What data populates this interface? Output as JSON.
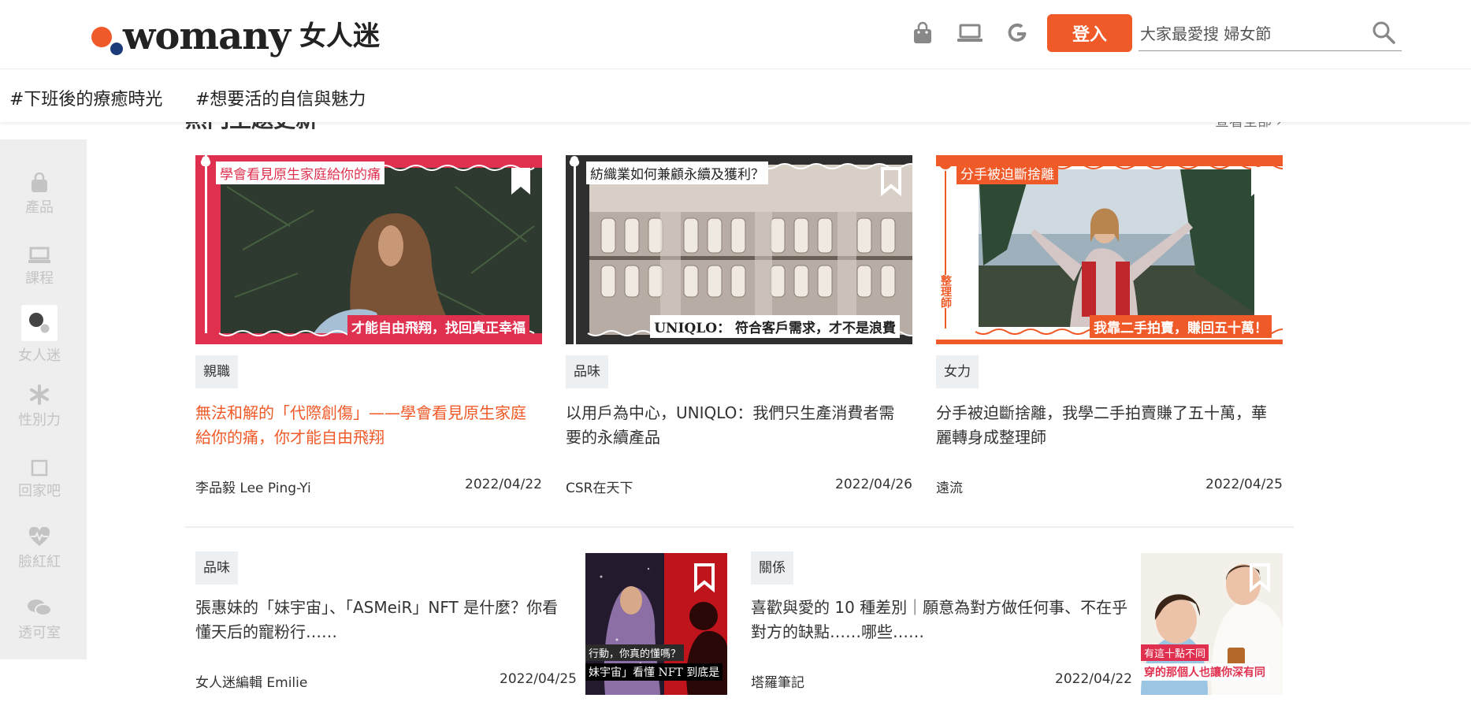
{
  "header": {
    "logo_word": "womany",
    "logo_cn": "女人迷",
    "login_label": "登入",
    "search_placeholder": "大家最愛搜 婦女節",
    "icons": [
      "shopping-bag-icon",
      "laptop-icon",
      "google-icon",
      "search-icon"
    ]
  },
  "tags": [
    "#下班後的療癒時光",
    "#想要活的自信與魅力"
  ],
  "sidebar": {
    "items": [
      {
        "label": "產品",
        "icon": "shopping-bag-icon"
      },
      {
        "label": "課程",
        "icon": "laptop-icon"
      },
      {
        "label": "女人迷",
        "icon": "womany-dots-icon"
      },
      {
        "label": "性別力",
        "icon": "asterisk-icon"
      },
      {
        "label": "回家吧",
        "icon": "square-icon"
      },
      {
        "label": "臉紅紅",
        "icon": "heart-pulse-icon"
      },
      {
        "label": "透可室",
        "icon": "chat-bubbles-icon"
      }
    ]
  },
  "section": {
    "title": "熱門主題更新",
    "more": "查看全部 ›"
  },
  "cards": [
    {
      "thumb_top": "學會看見原生家庭給你的痛",
      "thumb_bottom": "才能自由飛翔，找回真正幸福",
      "category": "親職",
      "title": "無法和解的「代際創傷」——學會看見原生家庭給你的痛，你才能自由飛翔",
      "author": "李品毅 Lee Ping-Yi",
      "date": "2022/04/22"
    },
    {
      "thumb_top": "紡織業如何兼顧永續及獲利？",
      "thumb_bottom": "UNIQLO： 符合客戶需求，才不是浪費",
      "category": "品味",
      "title": "以用戶為中心，UNIQLO：我們只生產消費者需要的永續產品",
      "author": "CSR在天下",
      "date": "2022/04/26"
    },
    {
      "thumb_top": "分手被迫斷捨離",
      "thumb_bottom": "我靠二手拍賣，賺回五十萬！",
      "thumb_side": "整理師",
      "category": "女力",
      "title": "分手被迫斷捨離，我學二手拍賣賺了五十萬，華麗轉身成整理師",
      "author": "遠流",
      "date": "2022/04/25"
    }
  ],
  "list_items": [
    {
      "category": "品味",
      "title": "張惠妹的「妹宇宙」、「ASMeiR」NFT 是什麼？你看懂天后的寵粉行……",
      "author": "女人迷編輯 Emilie",
      "date": "2022/04/25",
      "thumb_line1": "行動，你真的懂嗎？",
      "thumb_line2": "妹宇宙」看懂 NFT 到底是"
    },
    {
      "category": "關係",
      "title": "喜歡與愛的 10 種差別｜願意為對方做任何事、不在乎對方的缺點……哪些……",
      "author": "塔羅筆記",
      "date": "2022/04/22",
      "thumb_line1": "有這十點不同",
      "thumb_line2": "穿的那個人也讓你深有同"
    }
  ],
  "colors": {
    "brand": "#f05a28",
    "brand_blue": "#1c3b79",
    "card1_frame": "#e0304f",
    "card2_frame": "#2f2f2f",
    "card3_frame": "#f05a28"
  }
}
